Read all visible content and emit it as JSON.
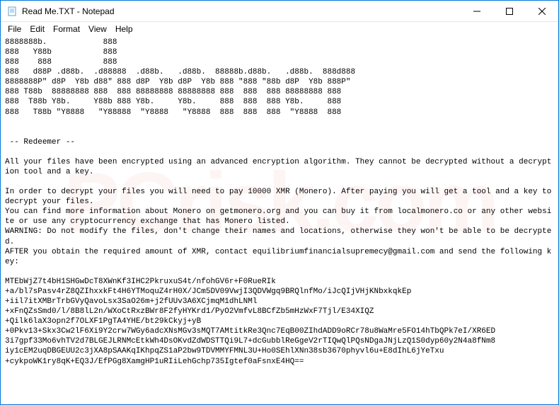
{
  "window": {
    "title": "Read Me.TXT - Notepad"
  },
  "menubar": {
    "file": "File",
    "edit": "Edit",
    "format": "Format",
    "view": "View",
    "help": "Help"
  },
  "content": {
    "ascii_art": "8888888b.            888\n888   Y88b           888\n888    888           888\n888   d88P .d88b.  .d88888  .d88b.   .d88b.  88888b.d88b.   .d88b.  888d888\n8888888P\" d8P  Y8b d88\" 888 d8P  Y8b d8P  Y8b 888 \"888 \"88b d8P  Y8b 888P\"\n888 T88b  88888888 888  888 88888888 88888888 888  888  888 88888888 888\n888  T88b Y8b.     Y88b 888 Y8b.     Y8b.     888  888  888 Y8b.     888\n888   T88b \"Y8888   \"Y88888  \"Y8888   \"Y8888  888  888  888  \"Y8888  888",
    "section_title": " -- Redeemer --",
    "paragraph1": "All your files have been encrypted using an advanced encryption algorithm. They cannot be decrypted without a decryption tool and a key.",
    "paragraph2": "In order to decrypt your files you will need to pay 10000 XMR (Monero). After paying you will get a tool and a key to decrypt your files.",
    "paragraph3": "You can find more information about Monero on getmonero.org and you can buy it from localmonero.co or any other website or use any cryptocurrency exchange that has Monero listed.",
    "paragraph4": "WARNING: Do not modify the files, don't change their names and locations, otherwise they won't be able to be decrypted.",
    "paragraph5": "AFTER you obtain the required amount of XMR, contact equilibriumfinancialsupremecy@gmail.com and send the following key:",
    "key_block": "MTEbWjZ7t4bH1SHGwDcT8XWnKf3IHC2PkruxuS4t/nfohGV6r+F0RueRIk\n+a/bl7sPasv4rZ8QZIhxxkFt4H6YTMoquZ4rH0X/JCm5DV09VwjI3QDVWgq9BRQlnfMo/iJcQIjVHjKNbxkqkEp\n+iil7itXMBrTrbGVyQavoLsx3SaO26m+j2fUUv3A6XCjmqM1dhLNMl\n+xFnQZsSmd0/l/8B8lL2n/WXoCtRxzBWr8F2fyHYKrd1/PyO2VmfvL8BCfZb5mHzWxF7Tjl/E34XIQZ\n+Qilk6laX3opn2f7OLXF1PgTA4YHE/bt29kCkyj+yB\n+0Pkv13+Skx3Cw2lF6Xi9Y2crw7WGy6adcXNsMGv3sMQT7AMtitkRe3Qnc7EqB00ZIhdADD9oRCr78u8WaMre5FO14hTbQPk7eI/XR6ED\n3i7gpf33Mo6vhTV2d7BLGEJLRNMcEtkWh4DsOKvdZdWDSTTQi9L7+dcGubblReGgeV2rTIQwQlPQsNDgaJNjLzQ1S0dyp60y2N4a8fNm8\niy1cEM2uqDBGEUU2c3jXA8pSAAKqIKhpqZS1aP2bw9TDVMMYFMNL3U+Ho0SEhlXNn38sb3670phyvl6u+E8dIhL6jYeTxu\n+cykpoWK1ry8qK+EQ3J/EfPGg8XamgHP1uRIiLehGchp735Igtef0aFsnxE4HQ=="
  },
  "watermark": "PCrisk.com"
}
